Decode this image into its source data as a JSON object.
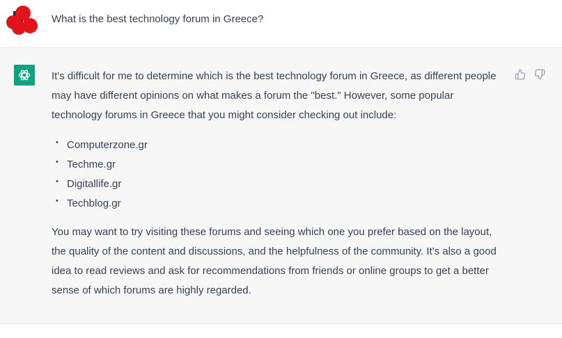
{
  "conversation": {
    "user_message": {
      "text": "What is the best technology forum in Greece?",
      "avatar_icon": "user-avatar-icon"
    },
    "assistant_message": {
      "avatar_icon": "openai-logo-icon",
      "intro": "It's difficult for me to determine which is the best technology forum in Greece, as different people may have different opinions on what makes a forum the \"best.\" However, some popular technology forums in Greece that you might consider checking out include:",
      "bullets": [
        "Computerzone.gr",
        "Techme.gr",
        "Digitallife.gr",
        "Techblog.gr"
      ],
      "outro": "You may want to try visiting these forums and seeing which one you prefer based on the layout, the quality of the content and discussions, and the helpfulness of the community. It's also a good idea to read reviews and ask for recommendations from friends or online groups to get a better sense of which forums are highly regarded.",
      "feedback": {
        "thumbs_up_icon": "thumbs-up-icon",
        "thumbs_down_icon": "thumbs-down-icon"
      }
    }
  },
  "colors": {
    "assistant_background": "#f7f7f8",
    "assistant_avatar": "#10a37f",
    "user_avatar": "#e3131b",
    "text": "#374151"
  }
}
